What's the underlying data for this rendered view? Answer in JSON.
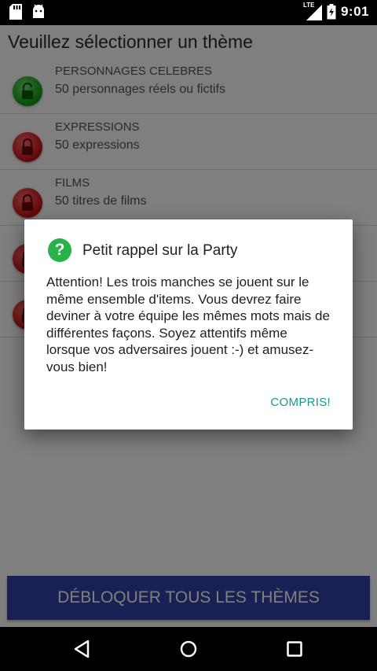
{
  "status_bar": {
    "time": "9:01",
    "network": "LTE",
    "icons": [
      "sd-card-icon",
      "android-icon",
      "signal-icon",
      "battery-icon"
    ]
  },
  "app": {
    "title": "Veuillez sélectionner un thème",
    "themes": [
      {
        "title": "PERSONNAGES CELEBRES",
        "subtitle": "50 personnages réels ou fictifs",
        "lock": "unlocked",
        "color": "#17a617"
      },
      {
        "title": "EXPRESSIONS",
        "subtitle": "50 expressions",
        "lock": "locked",
        "color": "#d11919"
      },
      {
        "title": "FILMS",
        "subtitle": "50 titres de films",
        "lock": "locked",
        "color": "#d11919"
      },
      {
        "title": "",
        "subtitle": "",
        "lock": "locked",
        "color": "#d11919"
      },
      {
        "title": "",
        "subtitle": "",
        "lock": "locked",
        "color": "#d11919"
      }
    ],
    "unlock_button": "DÉBLOQUER TOUS LES THÈMES"
  },
  "dialog": {
    "title": "Petit rappel sur la Party",
    "icon": "help-icon",
    "message": "Attention! Les trois manches se jouent sur le même ensemble d'items. Vous devrez faire deviner à votre équipe les mêmes mots mais de différentes façons. Soyez attentifs même lorsque vos adversaires jouent :-) et amusez-vous bien!",
    "ok_button": "COMPRIS!"
  },
  "colors": {
    "accent": "#129b8e",
    "button": "#3340a6",
    "help": "#27b34a"
  }
}
